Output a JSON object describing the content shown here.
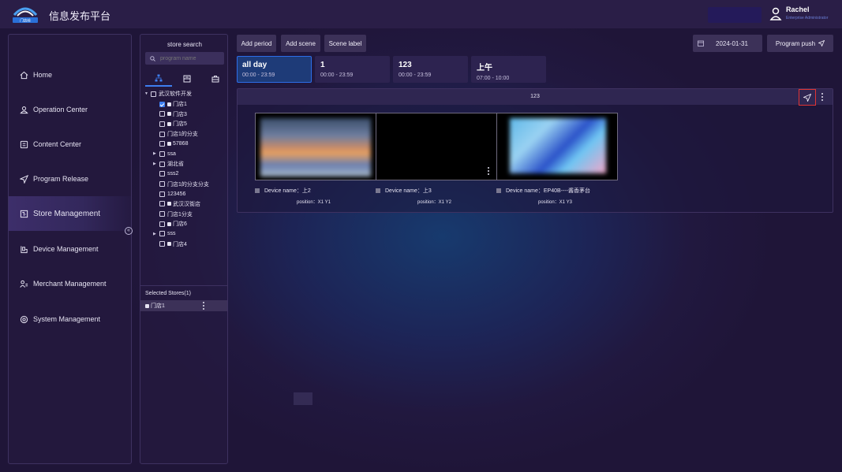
{
  "header": {
    "app_title": "信息发布平台",
    "user_name": "Rachel",
    "user_role": "Enterprise Administrator"
  },
  "sidebar": {
    "items": [
      {
        "label": "Home",
        "icon": "home-icon"
      },
      {
        "label": "Operation Center",
        "icon": "operation-icon"
      },
      {
        "label": "Content Center",
        "icon": "content-icon"
      },
      {
        "label": "Program Release",
        "icon": "send-icon"
      },
      {
        "label": "Store Management",
        "icon": "store-icon",
        "active": true
      },
      {
        "label": "Device Management",
        "icon": "device-icon"
      },
      {
        "label": "Merchant Management",
        "icon": "merchant-icon"
      },
      {
        "label": "System Management",
        "icon": "system-icon"
      }
    ]
  },
  "store_panel": {
    "title": "store search",
    "search_placeholder": "program name",
    "tree": [
      {
        "label": "武汉软件开发",
        "level": 0,
        "arrow": "▼",
        "store": false,
        "checked": false
      },
      {
        "label": "门店1",
        "level": 1,
        "store": true,
        "checked": true
      },
      {
        "label": "门店3",
        "level": 1,
        "store": true,
        "checked": false
      },
      {
        "label": "门店5",
        "level": 1,
        "store": true,
        "checked": false
      },
      {
        "label": "门店1的分支",
        "level": 1,
        "store": false,
        "checked": false
      },
      {
        "label": "57868",
        "level": 1,
        "store": true,
        "checked": false
      },
      {
        "label": "ssa",
        "level": 1,
        "arrow": "▶",
        "store": false,
        "checked": false
      },
      {
        "label": "湖北省",
        "level": 1,
        "arrow": "▶",
        "store": false,
        "checked": false
      },
      {
        "label": "sss2",
        "level": 1,
        "store": false,
        "checked": false
      },
      {
        "label": "门店1的分支分支",
        "level": 1,
        "store": false,
        "checked": false
      },
      {
        "label": "123456",
        "level": 1,
        "store": false,
        "checked": false
      },
      {
        "label": "武汉汉街店",
        "level": 1,
        "store": true,
        "checked": false
      },
      {
        "label": "门店1分支",
        "level": 1,
        "store": false,
        "checked": false
      },
      {
        "label": "门店6",
        "level": 1,
        "store": true,
        "checked": false
      },
      {
        "label": "sss",
        "level": 1,
        "arrow": "▶",
        "store": false,
        "checked": false
      },
      {
        "label": "门店4",
        "level": 1,
        "store": true,
        "checked": false
      }
    ],
    "selected_title": "Selected Stores(1)",
    "selected_store": "门店1"
  },
  "toolbar": {
    "add_period": "Add period",
    "add_scene": "Add scene",
    "scene_label": "Scene label",
    "date": "2024-01-31",
    "program_push": "Program push"
  },
  "periods": [
    {
      "name": "all day",
      "time": "00:00 - 23:59",
      "active": true
    },
    {
      "name": "1",
      "time": "00:00 - 23:59",
      "active": false
    },
    {
      "name": "123",
      "time": "00:00 - 23:59",
      "active": false
    },
    {
      "name": "上午",
      "time": "07:00 - 10:00",
      "active": false
    }
  ],
  "scene": {
    "title": "123",
    "devices": [
      {
        "name": "Device name：上2",
        "position": "position：X1 Y1"
      },
      {
        "name": "Device name：上3",
        "position": "position：X1 Y2"
      },
      {
        "name": "Device name：EP40B----酱香茅台",
        "position": "position：X1 Y3"
      }
    ]
  },
  "colors": {
    "accent": "#3e7ef0",
    "highlight_border": "#e03434",
    "active_period_bg": "#1e3b78"
  }
}
